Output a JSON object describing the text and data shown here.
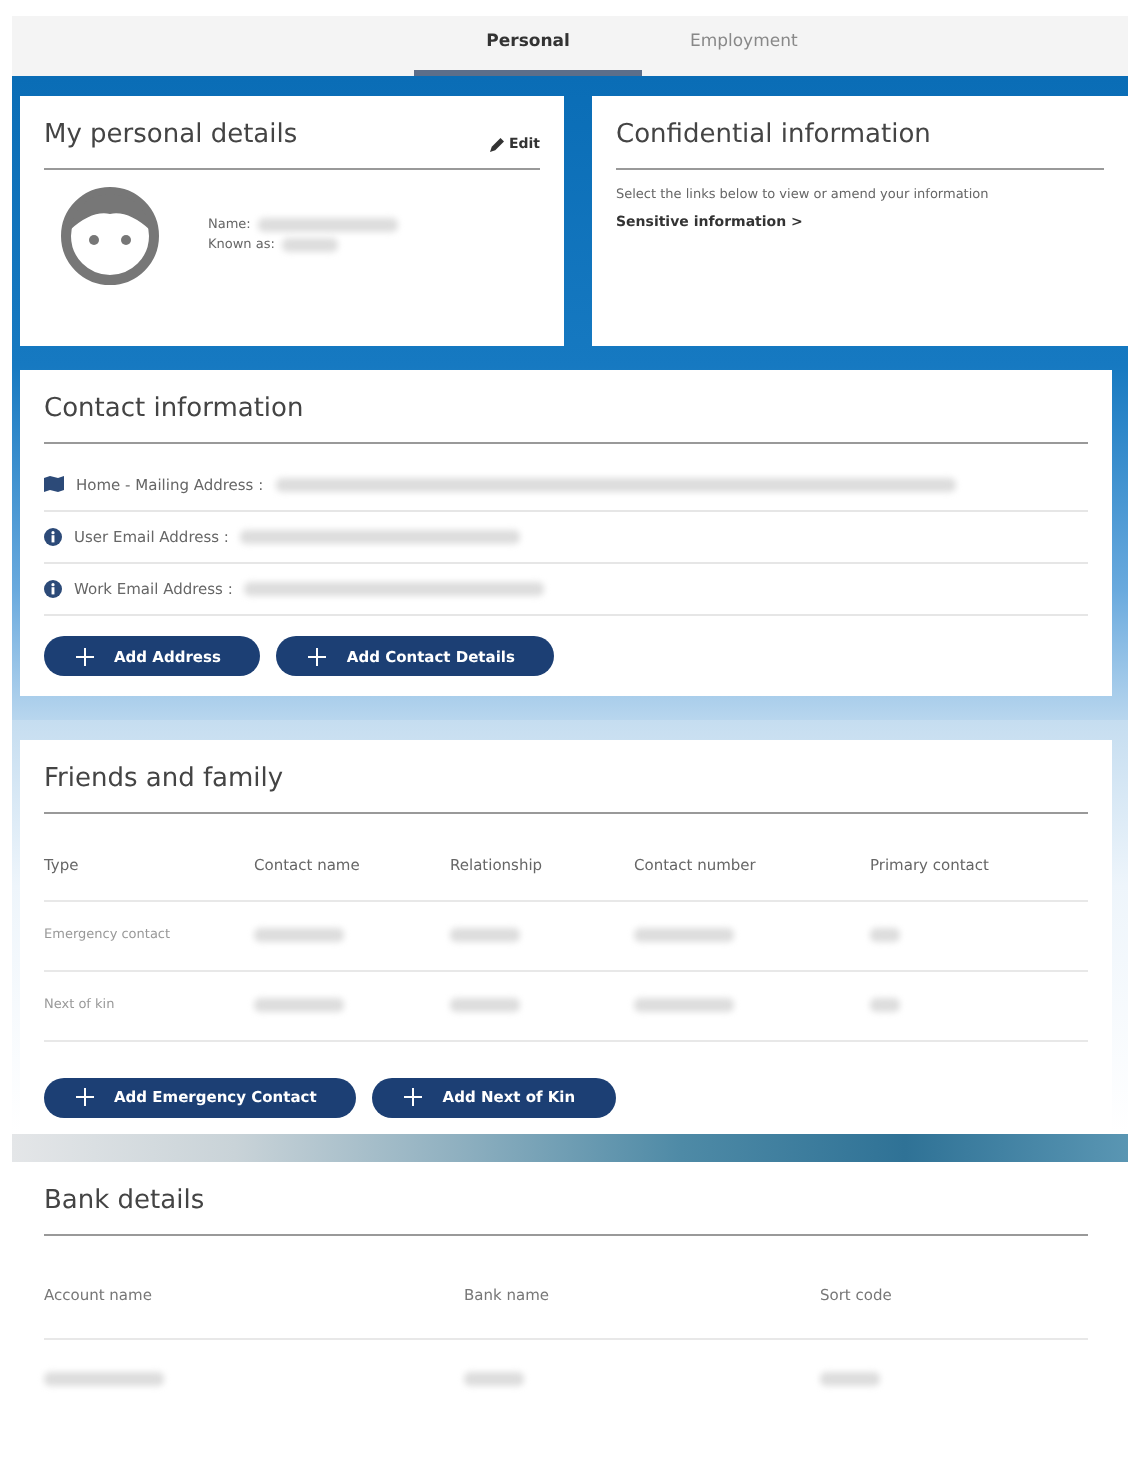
{
  "tabs": [
    {
      "label": "Personal",
      "selected": true
    },
    {
      "label": "Employment",
      "selected": false
    }
  ],
  "personal_details": {
    "title": "My personal details",
    "edit": "Edit",
    "fields": [
      {
        "label": "Name:"
      },
      {
        "label": "Known as:"
      }
    ]
  },
  "confidential": {
    "title": "Confidential information",
    "text": "Select the links below to view or amend your information",
    "link": "Sensitive information >"
  },
  "contact": {
    "title": "Contact information",
    "items": [
      {
        "kind": "address",
        "label": "Home - Mailing Address :"
      },
      {
        "kind": "info",
        "label": "User Email Address :"
      },
      {
        "kind": "info",
        "label": "Work Email Address :"
      }
    ],
    "buttons": [
      "Add Address",
      "Add Contact Details"
    ]
  },
  "friends": {
    "title": "Friends and family",
    "columns": [
      "Type",
      "Contact name",
      "Relationship",
      "Contact number",
      "Primary contact"
    ],
    "rows": [
      {
        "type": "Emergency contact"
      },
      {
        "type": "Next of kin"
      }
    ],
    "buttons": [
      "Add Emergency Contact",
      "Add Next of Kin"
    ]
  },
  "bank": {
    "title": "Bank details",
    "columns": [
      "Account name",
      "Bank name",
      "Sort code"
    ]
  }
}
